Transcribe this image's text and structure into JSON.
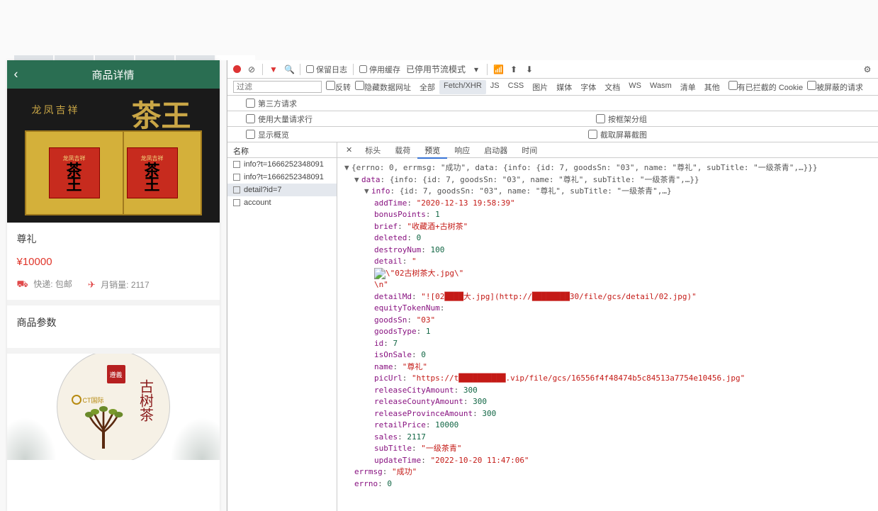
{
  "mobile": {
    "header_title": "商品详情",
    "hero_banner": "龙凤吉祥",
    "hero_king": "茶王",
    "label_small": "龙凤吉祥",
    "label_big_top": "茶",
    "label_big_bottom": "王",
    "product_name": "尊礼",
    "product_price": "¥10000",
    "shipping_label": "快递:",
    "shipping_value": "包邮",
    "sales_label": "月销量:",
    "sales_value": "2117",
    "params_title": "商品参数",
    "art_calli": "古树茶",
    "art_seal": "遵義",
    "art_brand": "CT国际"
  },
  "devtools": {
    "toolbar": {
      "preserve_log": "保留日志",
      "disable_cache": "停用缓存",
      "throttling_on": "已停用节流模式"
    },
    "filter": {
      "placeholder": "过滤",
      "invert": "反转",
      "hide_data_urls": "隐藏数据网址",
      "types": [
        "全部",
        "Fetch/XHR",
        "JS",
        "CSS",
        "图片",
        "媒体",
        "字体",
        "文档",
        "WS",
        "Wasm",
        "清单",
        "其他"
      ],
      "blocked_cookies": "有已拦截的 Cookie",
      "blocked_reqs": "被屏蔽的请求"
    },
    "opts": {
      "third_party": "第三方请求",
      "large_rows": "使用大量请求行",
      "group_by_frame": "按框架分组",
      "overview": "显示概览",
      "screenshots": "截取屏幕截图"
    },
    "req_header": "名称",
    "requests": [
      "info?t=1666252348091",
      "info?t=1666252348091",
      "detail?id=7",
      "account"
    ],
    "selected_index": 2,
    "detail_tabs": [
      "标头",
      "载荷",
      "预览",
      "响应",
      "启动器",
      "时间"
    ],
    "detail_active": 2
  },
  "response": {
    "summary": "{errno: 0, errmsg: \"成功\", data: {info: {id: 7, goodsSn: \"03\", name: \"尊礼\", subTitle: \"一级茶青\",…}}}",
    "data_summary": "{info: {id: 7, goodsSn: \"03\", name: \"尊礼\", subTitle: \"一级茶青\",…}}",
    "info_summary": "{id: 7, goodsSn: \"03\", name: \"尊礼\", subTitle: \"一级茶青\",…}",
    "fields": {
      "addTime": "\"2020-12-13 19:58:39\"",
      "bonusPoints": "1",
      "brief": "\"收藏酒+古树茶\"",
      "deleted": "0",
      "destroyNum": "100",
      "detail": "\"<p><img src=\\\"http://39.████████/file/gcs/detail/02.jpg\\\" alt=\\\"02古树茶大.jpg\\\" /></p>\\n\"",
      "detailMd": "\"![02████大.jpg](http://████████30/file/gcs/detail/02.jpg)\"",
      "equityTokenNum": "",
      "goodsSn": "\"03\"",
      "goodsType": "1",
      "id": "7",
      "isOnSale": "0",
      "name": "\"尊礼\"",
      "picUrl": "\"https://t██████████.vip/file/gcs/16556f4f48474b5c84513a7754e10456.jpg\"",
      "releaseCityAmount": "300",
      "releaseCountyAmount": "300",
      "releaseProvinceAmount": "300",
      "retailPrice": "10000",
      "sales": "2117",
      "subTitle": "\"一级茶青\"",
      "updateTime": "\"2022-10-20 11:47:06\""
    },
    "errmsg": "\"成功\"",
    "errno": "0"
  }
}
